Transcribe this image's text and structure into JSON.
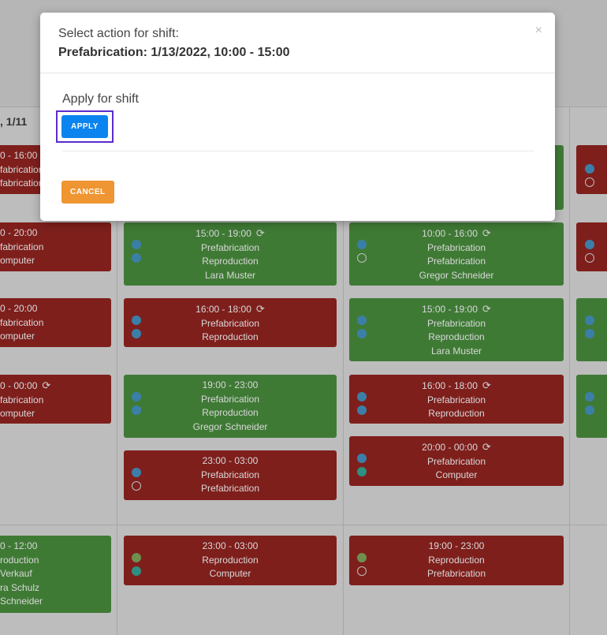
{
  "modal": {
    "subtitle": "Select action for shift:",
    "title": "Prefabrication: 1/13/2022, 10:00 - 15:00",
    "close_symbol": "×",
    "section_title": "Apply for shift",
    "apply_label": "APPLY",
    "cancel_label": "CANCEL"
  },
  "schedule": {
    "day_header": ", 1/11",
    "col0": [
      {
        "time": "0 - 16:00",
        "l1": "fabrication",
        "l2": "fabrication"
      },
      {
        "time": "0 - 20:00",
        "l1": "fabrication",
        "l2": "omputer"
      },
      {
        "time": "0 - 20:00",
        "l1": "fabrication",
        "l2": "omputer"
      },
      {
        "time": "0 - 00:00",
        "l1": "fabrication",
        "l2": "omputer"
      },
      {
        "time": "0 - 12:00",
        "l1": "roduction",
        "l2": "Verkauf",
        "l3": "ra Schulz",
        "l4": "Schneider"
      }
    ],
    "col1": [
      {
        "time": "15:00 - 19:00",
        "l1": "Prefabrication",
        "l2": "Reproduction",
        "l3": "Lara Muster"
      },
      {
        "time": "16:00 - 18:00",
        "l1": "Prefabrication",
        "l2": "Reproduction"
      },
      {
        "time": "19:00 - 23:00",
        "l1": "Prefabrication",
        "l2": "Reproduction",
        "l3": "Gregor Schneider"
      },
      {
        "time": "23:00 - 03:00",
        "l1": "Prefabrication",
        "l2": "Prefabrication"
      },
      {
        "time": "23:00 - 03:00",
        "l1": "Reproduction",
        "l2": "Computer"
      }
    ],
    "col2": [
      {
        "time": "10:00 - 16:00",
        "l1": "Prefabrication",
        "l2": "Prefabrication",
        "l3": "Gregor Schneider"
      },
      {
        "time": "15:00 - 19:00",
        "l1": "Prefabrication",
        "l2": "Reproduction",
        "l3": "Lara Muster"
      },
      {
        "time": "16:00 - 18:00",
        "l1": "Prefabrication",
        "l2": "Reproduction"
      },
      {
        "time": "20:00 - 00:00",
        "l1": "Prefabrication",
        "l2": "Computer"
      },
      {
        "time": "19:00 - 23:00",
        "l1": "Reproduction",
        "l2": "Prefabrication"
      }
    ]
  },
  "colors": {
    "shift_open": "#7e1f1c",
    "shift_assigned": "#3f7a35",
    "apply": "#0b84f0",
    "cancel": "#ef9532"
  }
}
